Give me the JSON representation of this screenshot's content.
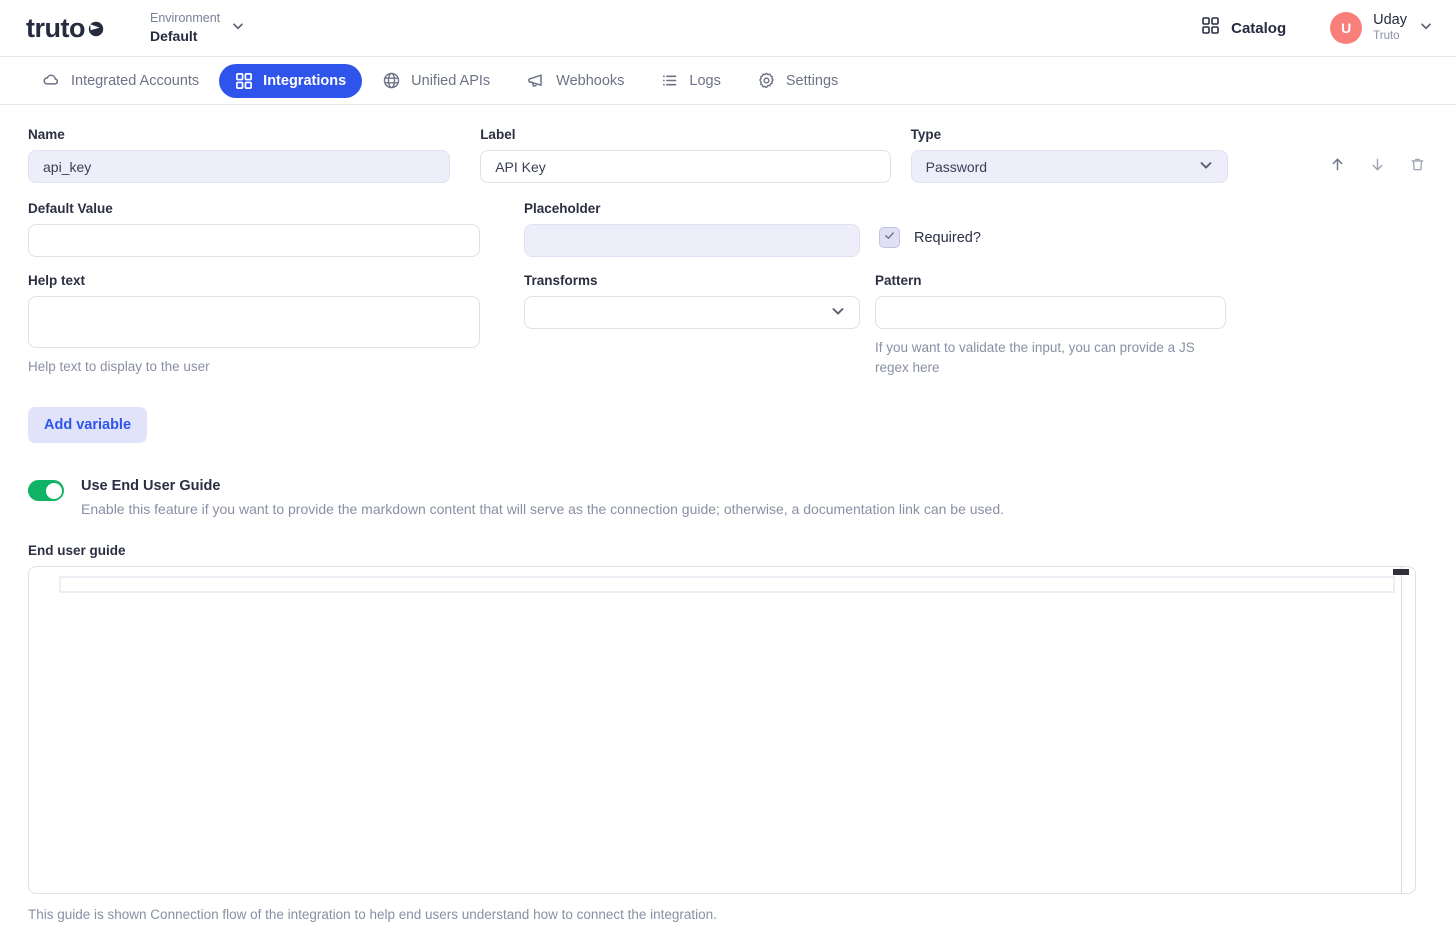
{
  "topbar": {
    "logo_text": "truto",
    "logo_icon": "truto-logo-mark",
    "environment_label": "Environment",
    "environment_value": "Default",
    "environment_chevron_icon": "chevron-down-icon",
    "catalog_label": "Catalog",
    "catalog_icon": "grid-icon",
    "user_initial": "U",
    "user_name": "Uday",
    "user_org": "Truto",
    "user_chevron_icon": "chevron-down-icon",
    "avatar_color": "#f9807a"
  },
  "nav": {
    "active_color": "#2f54eb",
    "tabs": [
      {
        "label": "Integrated Accounts",
        "icon": "cloud-icon",
        "active": false
      },
      {
        "label": "Integrations",
        "icon": "grid-icon",
        "active": true
      },
      {
        "label": "Unified APIs",
        "icon": "globe-icon",
        "active": false
      },
      {
        "label": "Webhooks",
        "icon": "megaphone-icon",
        "active": false
      },
      {
        "label": "Logs",
        "icon": "list-icon",
        "active": false
      },
      {
        "label": "Settings",
        "icon": "gear-icon",
        "active": false
      }
    ]
  },
  "variable_form": {
    "name": {
      "label": "Name",
      "value": "api_key",
      "placeholder": ""
    },
    "field_label": {
      "label": "Label",
      "value": "API Key",
      "placeholder": ""
    },
    "type": {
      "label": "Type",
      "value": "Password",
      "chevron_icon": "chevron-down-icon"
    },
    "row_actions": {
      "move_up_icon": "arrow-up-icon",
      "move_down_icon": "arrow-down-icon",
      "delete_icon": "trash-icon"
    },
    "default_value": {
      "label": "Default Value",
      "value": "",
      "placeholder": ""
    },
    "placeholder_field": {
      "label": "Placeholder",
      "value": "",
      "placeholder": ""
    },
    "required": {
      "label": "Required?",
      "checked": true,
      "check_icon": "check-icon"
    },
    "help_text": {
      "label": "Help text",
      "value": "",
      "hint": "Help text to display to the user"
    },
    "transforms": {
      "label": "Transforms",
      "value": "",
      "chevron_icon": "chevron-down-icon"
    },
    "pattern": {
      "label": "Pattern",
      "value": "",
      "hint": "If you want to validate the input, you can provide a JS regex here"
    },
    "add_variable_label": "Add variable"
  },
  "end_user_guide": {
    "toggle_title": "Use End User Guide",
    "toggle_enabled": true,
    "toggle_color": "#10b266",
    "toggle_description": "Enable this feature if you want to provide the markdown content that will serve as the connection guide; otherwise, a documentation link can be used.",
    "editor_label": "End user guide",
    "editor_value": "",
    "bottom_hint": "This guide is shown Connection flow of the integration to help end users understand how to connect the integration."
  }
}
